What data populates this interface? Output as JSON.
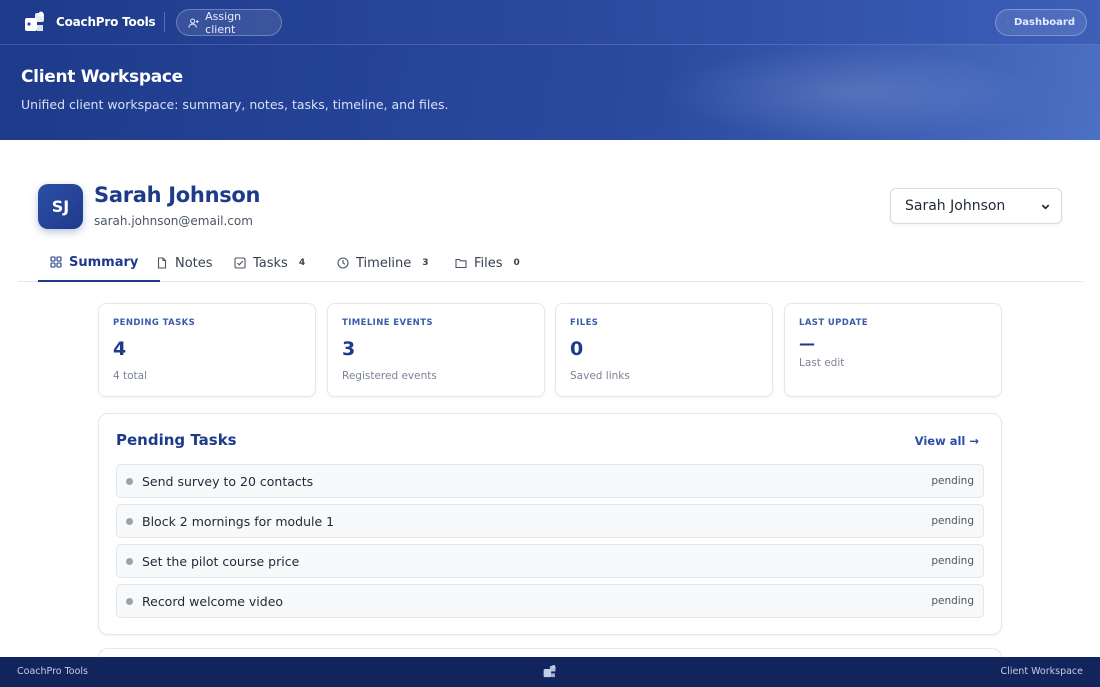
{
  "topbar": {
    "brand": "CoachPro Tools",
    "assign_label": "Assign client",
    "dashboard_label": "Dashboard"
  },
  "hero": {
    "title": "Client Workspace",
    "subtitle": "Unified client workspace: summary, notes, tasks, timeline, and files."
  },
  "client": {
    "initials": "SJ",
    "name": "Sarah Johnson",
    "email": "sarah.johnson@email.com",
    "selected": "Sarah Johnson"
  },
  "tabs": [
    {
      "label": "Summary",
      "count": "",
      "icon": "grid-icon",
      "active": true
    },
    {
      "label": "Notes",
      "count": "",
      "icon": "document-icon",
      "active": false
    },
    {
      "label": "Tasks",
      "count": "4",
      "icon": "checkbox-icon",
      "active": false
    },
    {
      "label": "Timeline",
      "count": "3",
      "icon": "clock-icon",
      "active": false
    },
    {
      "label": "Files",
      "count": "0",
      "icon": "folder-icon",
      "active": false
    }
  ],
  "stats": [
    {
      "label": "PENDING TASKS",
      "value": "4",
      "sub": "4 total"
    },
    {
      "label": "TIMELINE EVENTS",
      "value": "3",
      "sub": "Registered events"
    },
    {
      "label": "FILES",
      "value": "0",
      "sub": "Saved links"
    },
    {
      "label": "LAST UPDATE",
      "value": "—",
      "sub": "Last edit"
    }
  ],
  "pending": {
    "title": "Pending Tasks",
    "view_all": "View all →",
    "tasks": [
      {
        "text": "Send survey to 20 contacts",
        "status": "pending"
      },
      {
        "text": "Block 2 mornings for module 1",
        "status": "pending"
      },
      {
        "text": "Set the pilot course price",
        "status": "pending"
      },
      {
        "text": "Record welcome video",
        "status": "pending"
      }
    ]
  },
  "footer": {
    "left": "CoachPro Tools",
    "right": "Client Workspace"
  },
  "colors": {
    "primary": "#1e3a8a",
    "accent": "#2d4ea8",
    "footer_bg": "#12245c"
  }
}
